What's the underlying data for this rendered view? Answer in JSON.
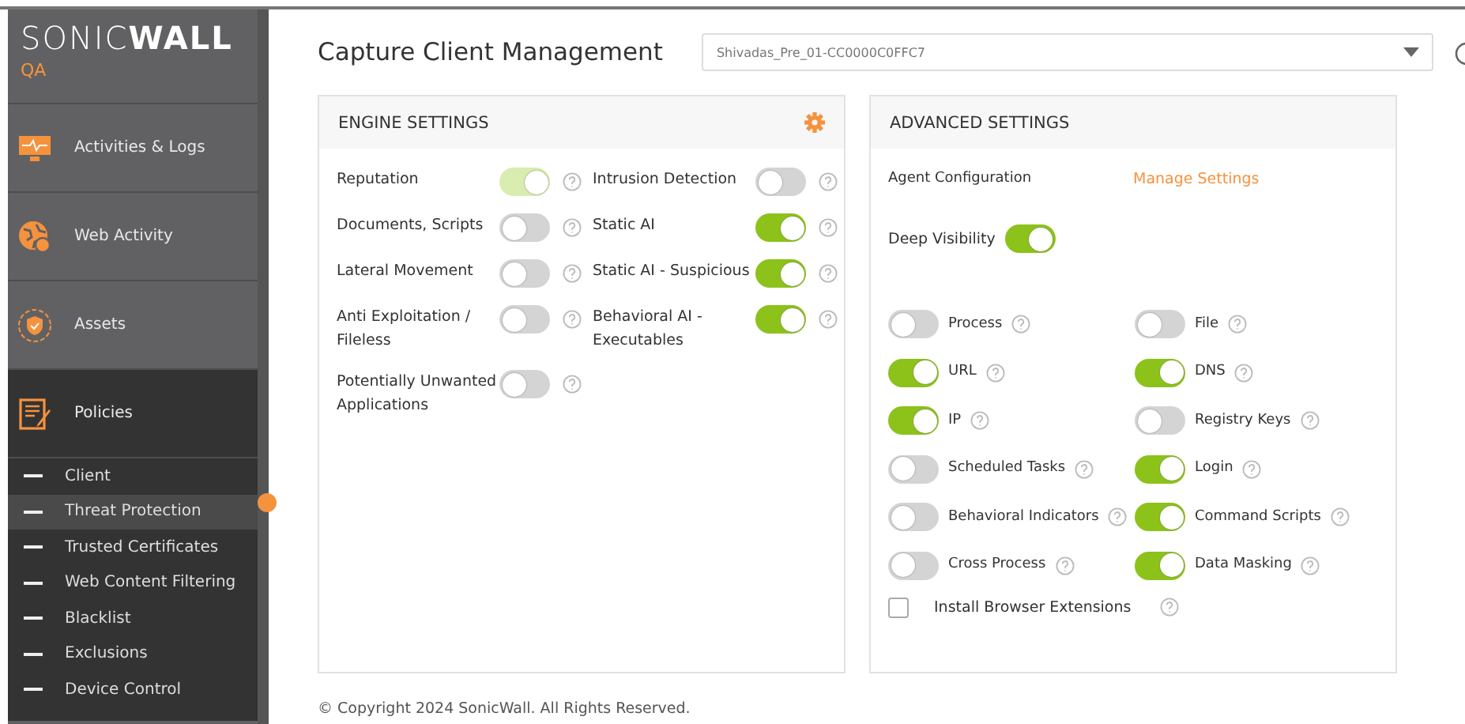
{
  "sidebar": {
    "logo": "SONIC**WALL**",
    "environment": "QA",
    "items": [
      {
        "label": "Activities & Logs",
        "selected": false
      },
      {
        "label": "Web Activity",
        "selected": false
      },
      {
        "label": "Assets",
        "selected": false
      },
      {
        "label": "Policies",
        "selected": true,
        "children": [
          {
            "label": "Client",
            "selected": false
          },
          {
            "label": "Threat Protection",
            "selected": true
          },
          {
            "label": "Trusted Certificates",
            "selected": false
          },
          {
            "label": "Web Content Filtering",
            "selected": false
          },
          {
            "label": "Blacklist",
            "selected": false
          },
          {
            "label": "Exclusions",
            "selected": false
          },
          {
            "label": "Device Control",
            "selected": false
          }
        ]
      }
    ]
  },
  "header": {
    "title": "Capture Client Management",
    "policy_select": {
      "value": "Shivadas_Pre_01-CC0000C0FFC7"
    }
  },
  "engine_settings": {
    "title": "ENGINE SETTINGS",
    "settings": [
      {
        "label": "Reputation",
        "on": true,
        "disabled": true
      },
      {
        "label": "Intrusion Detection",
        "on": false,
        "disabled": false
      },
      {
        "label": "Documents, Scripts",
        "on": false,
        "disabled": false
      },
      {
        "label": "Static AI",
        "on": true,
        "disabled": false
      },
      {
        "label": "Lateral Movement",
        "on": false,
        "disabled": false
      },
      {
        "label": "Static AI - Suspicious",
        "on": true,
        "disabled": false
      },
      {
        "label": "Anti Exploitation / Fileless",
        "on": false,
        "disabled": false
      },
      {
        "label": "Behavioral AI - Executables",
        "on": true,
        "disabled": false
      },
      {
        "label": "Potentially Unwanted Applications",
        "on": false,
        "disabled": false
      }
    ]
  },
  "advanced_settings": {
    "title": "ADVANCED SETTINGS",
    "agent_configuration": {
      "label": "Agent Configuration",
      "link": "Manage Settings"
    },
    "deep_visibility": {
      "label": "Deep Visibility",
      "on": true
    },
    "settings": [
      {
        "label": "Process",
        "on": false
      },
      {
        "label": "File",
        "on": false
      },
      {
        "label": "URL",
        "on": true
      },
      {
        "label": "DNS",
        "on": true
      },
      {
        "label": "IP",
        "on": true
      },
      {
        "label": "Registry Keys",
        "on": false
      },
      {
        "label": "Scheduled Tasks",
        "on": false
      },
      {
        "label": "Login",
        "on": true
      },
      {
        "label": "Behavioral Indicators",
        "on": false
      },
      {
        "label": "Command Scripts",
        "on": true
      },
      {
        "label": "Cross Process",
        "on": false
      },
      {
        "label": "Data Masking",
        "on": true
      }
    ],
    "install_browser_extensions": {
      "label": "Install Browser Extensions",
      "checked": false
    }
  },
  "footer": "© Copyright 2024 SonicWall. All Rights Reserved."
}
